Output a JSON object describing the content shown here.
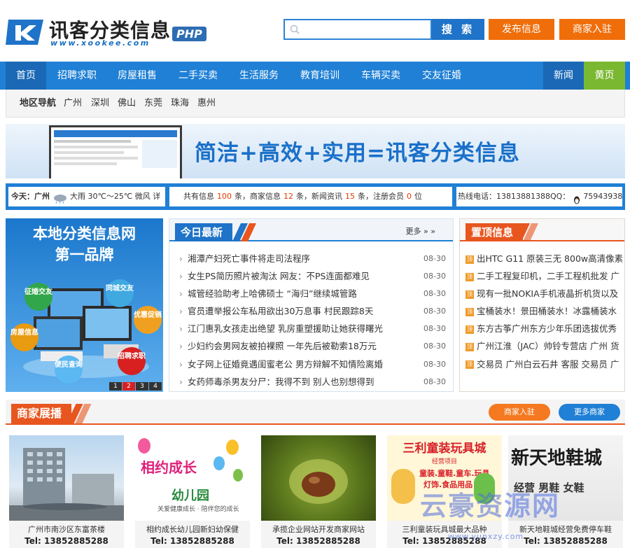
{
  "header": {
    "logo_title": "讯客分类信息",
    "logo_url": "www.xookee.com",
    "logo_badge": "PHP",
    "search_placeholder": "",
    "search_button": "搜 索",
    "post_button": "发布信息",
    "merchant_button": "商家入驻"
  },
  "nav": {
    "items": [
      "首页",
      "招聘求职",
      "房屋租售",
      "二手买卖",
      "生活服务",
      "教育培训",
      "车辆买卖",
      "交友征婚"
    ],
    "right_items": [
      "新闻",
      "黄页"
    ]
  },
  "region": {
    "title": "地区导航",
    "cities": [
      "广州",
      "深圳",
      "佛山",
      "东莞",
      "珠海",
      "惠州"
    ]
  },
  "banner": {
    "slogan": "简洁+高效+实用=讯客分类信息"
  },
  "infobar": {
    "weather": "今天：广州",
    "weather_detail": "大雨 30℃～25℃ 微风 详",
    "stats_prefix": "共有信息",
    "info_count": "100",
    "stats_mid1": "条，商家信息",
    "merchant_count": "12",
    "stats_mid2": "条，新闻资讯",
    "news_count": "15",
    "stats_mid3": "条，注册会员",
    "member_count": "0",
    "stats_suffix": "位",
    "hotline": "热线电话：13813881388QQ：",
    "qq": "75943938"
  },
  "left_ad": {
    "title1": "本地分类信息网",
    "title2": "第一品牌",
    "bubbles": [
      "征婚交友",
      "同城交友",
      "优惠促销",
      "房屋信息",
      "招聘求职",
      "便民查询"
    ],
    "pages": [
      "1",
      "2",
      "3",
      "4"
    ]
  },
  "news": {
    "title": "今日最新",
    "more": "更多 » »",
    "items": [
      {
        "title": "湘潭产妇死亡事件将走司法程序",
        "date": "08-30"
      },
      {
        "title": "女生PS简历照片被淘汰 网友：不PS连面都难见",
        "date": "08-30"
      },
      {
        "title": "城管经验助考上哈佛硕士 “海归”继续城管路",
        "date": "08-30"
      },
      {
        "title": "官员遭举报公车私用欲出30万息事 村民跟踪8天",
        "date": "08-30"
      },
      {
        "title": "江门惠乳女孩走出绝望 乳房重塑援助让她获得曙光",
        "date": "08-30"
      },
      {
        "title": "少妇约会男网友被拍裸照 一年先后被勒索18万元",
        "date": "08-30"
      },
      {
        "title": "女子网上征婚竟遇闺蜜老公 男方辩解不知情险离婚",
        "date": "08-30"
      },
      {
        "title": "女药师毒杀男友分尸：我得不到 别人也别想得到",
        "date": "08-30"
      }
    ]
  },
  "top_info": {
    "title": "置顶信息",
    "icon_label": "顶",
    "items": [
      "出HTC G11 原装三无 800w高清像素",
      "二手工程复印机，二手工程机批发 广",
      "现有一批NOKIA手机液晶折机货以及",
      "宝桶装水！景田桶装水！冰露桶装水",
      "东方古筝广州东方少年乐团选拔优秀",
      "广州江淮（JAC）帅铃专营店 广州 货",
      "交易员 广州白云石井 客服 交易员 广"
    ]
  },
  "merchants": {
    "title": "商家展播",
    "join_button": "商家入驻",
    "more_button": "更多商家",
    "cards": [
      {
        "name": "广州市南沙区东富茶楼",
        "tel": "Tel: 13852885288"
      },
      {
        "name": "相约成长幼儿园新妇幼保健",
        "tel": "Tel: 13852885288"
      },
      {
        "name": "承揽企业网站开发商家网站",
        "tel": "Tel: 13852885288"
      },
      {
        "name": "三利童装玩具城最大品种",
        "tel": "Tel: 13852885288"
      },
      {
        "name": "新天地鞋城经营免费停车鞋",
        "tel": "Tel: 13852885288"
      }
    ],
    "card_texts": {
      "kinder_sign1": "相约成长",
      "kinder_sign2": "幼儿园",
      "kinder_sub": "关爱健康成长 · 陪伴您的成长",
      "toy_sign": "三利童装玩具城",
      "toy_sub": "经营项目",
      "toy_line1": "童装.童鞋.童车.玩具",
      "toy_line2": "灯饰.食品用品",
      "shoe_sign": "新天地鞋城",
      "shoe_sub": "经营 男鞋 女鞋"
    }
  },
  "watermark": {
    "text": "云豪资源网",
    "url": "www.yunxzy.com"
  },
  "colors": {
    "primary_blue": "#1f80d5",
    "orange": "#f06e0a",
    "red_orange": "#e8561f",
    "green": "#7bb831"
  }
}
